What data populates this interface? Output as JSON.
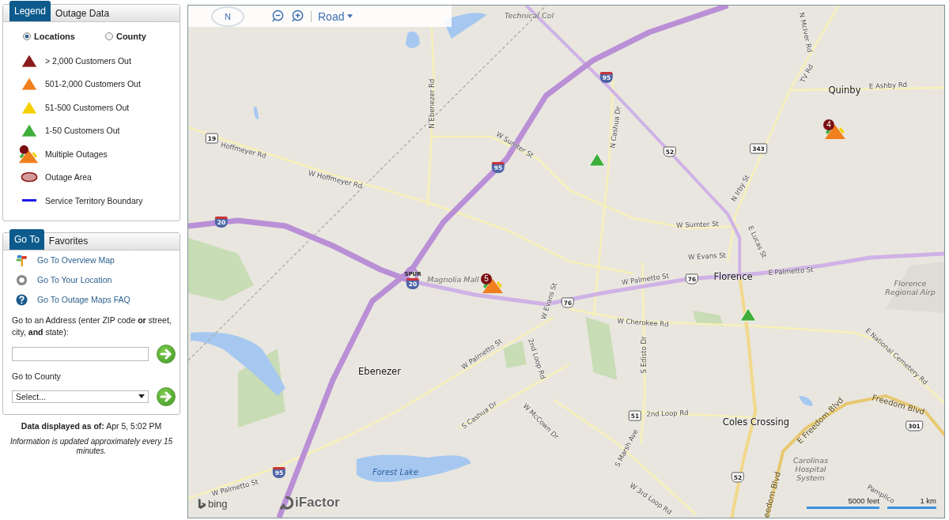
{
  "legend_panel": {
    "tabs": [
      {
        "label": "Legend",
        "selected": true
      },
      {
        "label": "Outage Data",
        "selected": false
      }
    ],
    "view_options": [
      {
        "label": "Locations",
        "selected": true
      },
      {
        "label": "County",
        "selected": false
      }
    ],
    "items": [
      {
        "label": "> 2,000 Customers Out",
        "kind": "triangle",
        "color": "#8b1a1a"
      },
      {
        "label": "501-2,000 Customers Out",
        "kind": "triangle",
        "color": "#f07f1e"
      },
      {
        "label": "51-500 Customers Out",
        "kind": "triangle",
        "color": "#f7d000"
      },
      {
        "label": "1-50 Customers Out",
        "kind": "triangle",
        "color": "#3fae3a"
      },
      {
        "label": "Multiple Outages",
        "kind": "multiple"
      },
      {
        "label": "Outage Area",
        "kind": "area"
      },
      {
        "label": "Service Territory Boundary",
        "kind": "line",
        "color": "#1a1ae6"
      }
    ]
  },
  "goto_panel": {
    "tabs": [
      {
        "label": "Go To",
        "selected": true
      },
      {
        "label": "Favorites",
        "selected": false
      }
    ],
    "links": [
      {
        "label": "Go To Overview Map",
        "kind": "map"
      },
      {
        "label": "Go To Your Location",
        "kind": "location"
      },
      {
        "label": "Go To Outage Maps FAQ",
        "kind": "help"
      }
    ],
    "address": {
      "label": "Go to an Address (enter ZIP code **or** street, city, **and** state):"
    },
    "county": {
      "label": "Go to County",
      "value": "Select..."
    }
  },
  "data_timestamp": "**Data displayed as of:** Apr 5, 5:02 PM",
  "update_note": "Information is updated approximately every 15 minutes.",
  "map": {
    "toolbar": {
      "compass": "N",
      "map_style": "Road"
    },
    "labels": [
      {
        "text": "Technical Col",
        "kind": "poi"
      },
      {
        "text": "19",
        "kind": "shield-state"
      },
      {
        "text": "Hoffmeyer Rd",
        "kind": "road"
      },
      {
        "text": "W Hoffmeyer Rd",
        "kind": "road"
      },
      {
        "text": "N Ebenezer Rd",
        "kind": "road"
      },
      {
        "text": "W Sumter St",
        "kind": "road"
      },
      {
        "text": "95",
        "kind": "shield-interstate"
      },
      {
        "text": "20",
        "kind": "shield-interstate"
      },
      {
        "text": "N McIver Rd",
        "kind": "road"
      },
      {
        "text": "95",
        "kind": "shield-interstate"
      },
      {
        "text": "TV Rd",
        "kind": "road"
      },
      {
        "text": "Quinby",
        "kind": "place"
      },
      {
        "text": "E Ashby Rd",
        "kind": "road"
      },
      {
        "text": "N Cashua Dr",
        "kind": "road"
      },
      {
        "text": "52",
        "kind": "shield-us"
      },
      {
        "text": "343",
        "kind": "shield-state"
      },
      {
        "text": "N Irby St",
        "kind": "road"
      },
      {
        "text": "W Sumter St",
        "kind": "road"
      },
      {
        "text": "E Lucas St",
        "kind": "road"
      },
      {
        "text": "W Evans St",
        "kind": "road"
      },
      {
        "text": "SPUR",
        "kind": "shield-caption"
      },
      {
        "text": "20",
        "kind": "shield-interstate"
      },
      {
        "text": "Magnolia Mall",
        "kind": "poi"
      },
      {
        "text": "W Palmetto St",
        "kind": "road"
      },
      {
        "text": "76",
        "kind": "shield-us"
      },
      {
        "text": "Florence",
        "kind": "place"
      },
      {
        "text": "E Palmetto St",
        "kind": "road"
      },
      {
        "text": "Florence Regional Airp",
        "kind": "poi"
      },
      {
        "text": "W Evans St",
        "kind": "road"
      },
      {
        "text": "76",
        "kind": "shield-us"
      },
      {
        "text": "W Cherokee Rd",
        "kind": "road"
      },
      {
        "text": "2nd Loop Rd",
        "kind": "road"
      },
      {
        "text": "W Palmetto St",
        "kind": "road"
      },
      {
        "text": "S Edisto Dr",
        "kind": "road"
      },
      {
        "text": "E National Cemetery Rd",
        "kind": "road"
      },
      {
        "text": "Ebenezer",
        "kind": "place"
      },
      {
        "text": "S Cashua Dr",
        "kind": "road"
      },
      {
        "text": "W McCown Dr",
        "kind": "road"
      },
      {
        "text": "51",
        "kind": "shield-state"
      },
      {
        "text": "2nd Loop Rd",
        "kind": "road"
      },
      {
        "text": "Coles Crossing",
        "kind": "place"
      },
      {
        "text": "Freedom Blvd",
        "kind": "major"
      },
      {
        "text": "E Freedom Blvd",
        "kind": "major"
      },
      {
        "text": "301",
        "kind": "shield-us"
      },
      {
        "text": "S Marsh Ave",
        "kind": "road"
      },
      {
        "text": "95",
        "kind": "shield-interstate"
      },
      {
        "text": "Forest Lake",
        "kind": "water"
      },
      {
        "text": "52",
        "kind": "shield-us"
      },
      {
        "text": "Carolinas Hospital System",
        "kind": "poi"
      },
      {
        "text": "W Palmetto St",
        "kind": "road"
      },
      {
        "text": "W 3rd Loop Rd",
        "kind": "road"
      },
      {
        "text": "eedom Blvd",
        "kind": "major"
      },
      {
        "text": "Pamplico",
        "kind": "road"
      }
    ],
    "markers": [
      {
        "kind": "multiple",
        "count": "4"
      },
      {
        "kind": "single",
        "color": "#3fae3a"
      },
      {
        "kind": "multiple",
        "count": "5"
      },
      {
        "kind": "single",
        "color": "#3fae3a"
      }
    ],
    "attribution": [
      "bing",
      "iFactor"
    ],
    "scale": [
      "5000 feet",
      "1 km"
    ]
  }
}
